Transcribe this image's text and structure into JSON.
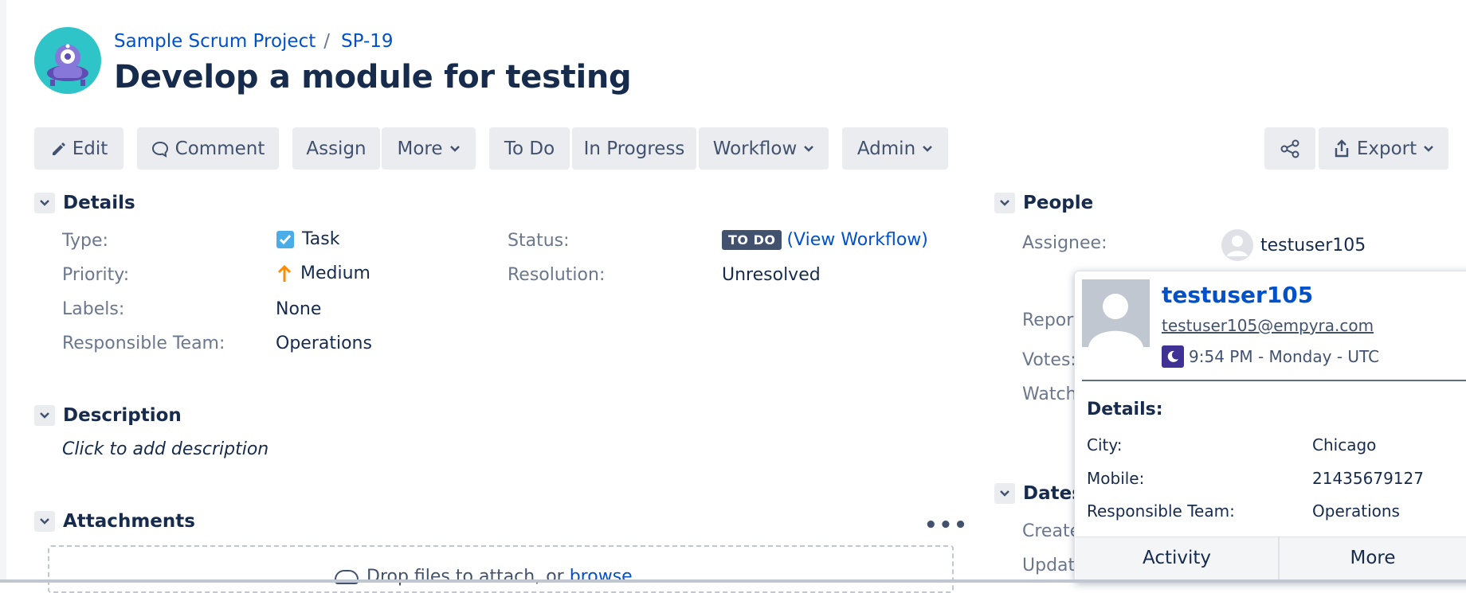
{
  "breadcrumb": {
    "project": "Sample Scrum Project",
    "separator": "/",
    "issue_key": "SP-19"
  },
  "issue": {
    "title": "Develop a module for testing"
  },
  "toolbar": {
    "edit": "Edit",
    "comment": "Comment",
    "assign": "Assign",
    "more": "More",
    "todo": "To Do",
    "in_progress": "In Progress",
    "workflow": "Workflow",
    "admin": "Admin",
    "export": "Export"
  },
  "details": {
    "heading": "Details",
    "type_label": "Type:",
    "type_value": "Task",
    "priority_label": "Priority:",
    "priority_value": "Medium",
    "labels_label": "Labels:",
    "labels_value": "None",
    "team_label": "Responsible Team:",
    "team_value": "Operations",
    "status_label": "Status:",
    "status_value": "TO DO",
    "view_workflow": "(View Workflow)",
    "resolution_label": "Resolution:",
    "resolution_value": "Unresolved"
  },
  "description": {
    "heading": "Description",
    "placeholder": "Click to add description"
  },
  "attachments": {
    "heading": "Attachments",
    "dropzone_prefix": "Drop files to attach, or",
    "browse": "browse"
  },
  "people": {
    "heading": "People",
    "assignee_label": "Assignee:",
    "assignee_value": "testuser105",
    "reporter_label_partial": "Repor",
    "votes_label_partial": "Votes:",
    "watchers_label_partial": "Watch"
  },
  "dates": {
    "heading_partial": "Dates",
    "created_partial": "Create",
    "updated_partial": "Updat"
  },
  "user_card": {
    "name": "testuser105",
    "email": "testuser105@empyra.com",
    "time": "9:54 PM - Monday - UTC",
    "details_heading": "Details:",
    "city_label": "City:",
    "city_value": "Chicago",
    "mobile_label": "Mobile:",
    "mobile_value": "21435679127",
    "team_label": "Responsible Team:",
    "team_value": "Operations",
    "activity": "Activity",
    "more": "More"
  },
  "colors": {
    "link": "#0052cc",
    "button_bg": "#ebecf0",
    "lozenge_todo": "#42526e",
    "priority_medium": "#ff8b00",
    "task_icon": "#4bade8"
  }
}
